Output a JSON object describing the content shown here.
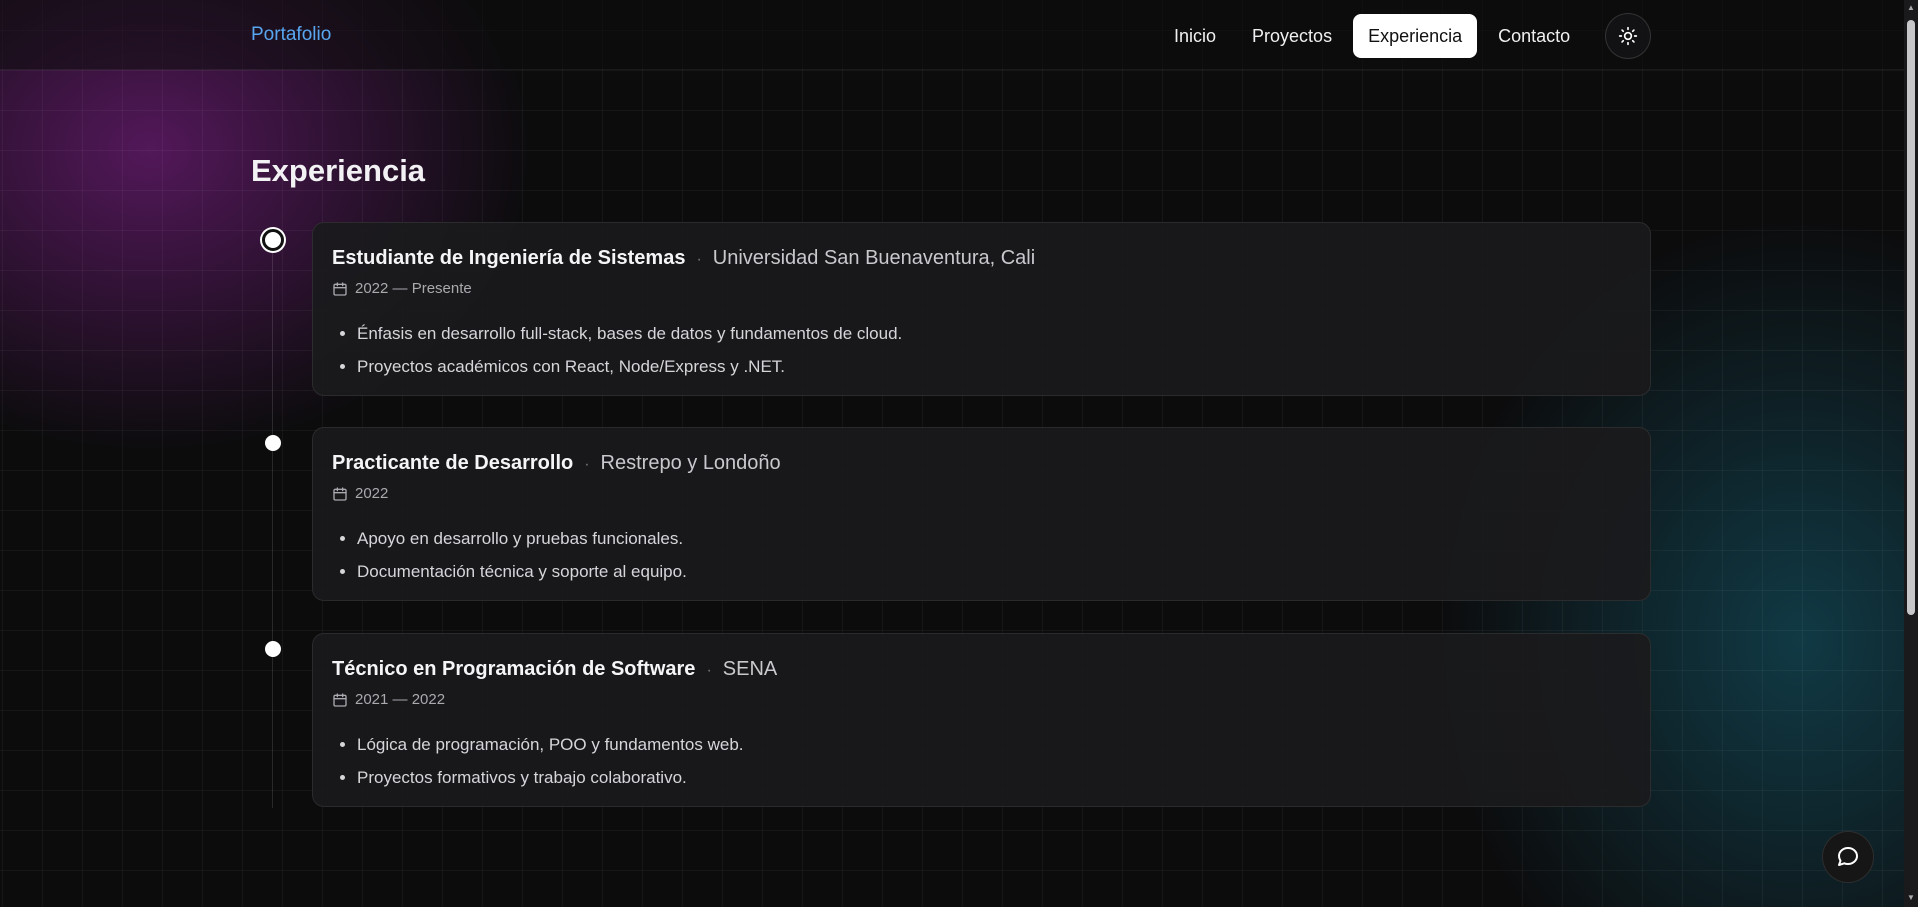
{
  "header": {
    "brand": "Portafolio",
    "nav": [
      {
        "label": "Inicio",
        "active": false
      },
      {
        "label": "Proyectos",
        "active": false
      },
      {
        "label": "Experiencia",
        "active": true
      },
      {
        "label": "Contacto",
        "active": false
      }
    ],
    "theme_toggle_icon": "sun-icon"
  },
  "section": {
    "title": "Experiencia"
  },
  "experience": [
    {
      "role": "Estudiante de Ingeniería de Sistemas",
      "org": "Universidad San Buenaventura, Cali",
      "date": "2022 — Presente",
      "bullets": [
        "Énfasis en desarrollo full-stack, bases de datos y fundamentos de cloud.",
        "Proyectos académicos con React, Node/Express y .NET."
      ]
    },
    {
      "role": "Practicante de Desarrollo",
      "org": "Restrepo y Londoño",
      "date": "2022",
      "bullets": [
        "Apoyo en desarrollo y pruebas funcionales.",
        "Documentación técnica y soporte al equipo."
      ]
    },
    {
      "role": "Técnico en Programación de Software",
      "org": "SENA",
      "date": "2021 — 2022",
      "bullets": [
        "Lógica de programación, POO y fundamentos web.",
        "Proyectos formativos y trabajo colaborativo."
      ]
    }
  ],
  "separator": "·",
  "chat_icon": "chat-bubble-icon",
  "colors": {
    "brand": "#58a6f0",
    "background": "#0c0c0d",
    "card": "#1a1a1c",
    "accent_purple": "#781e82",
    "accent_teal": "#145f73"
  }
}
